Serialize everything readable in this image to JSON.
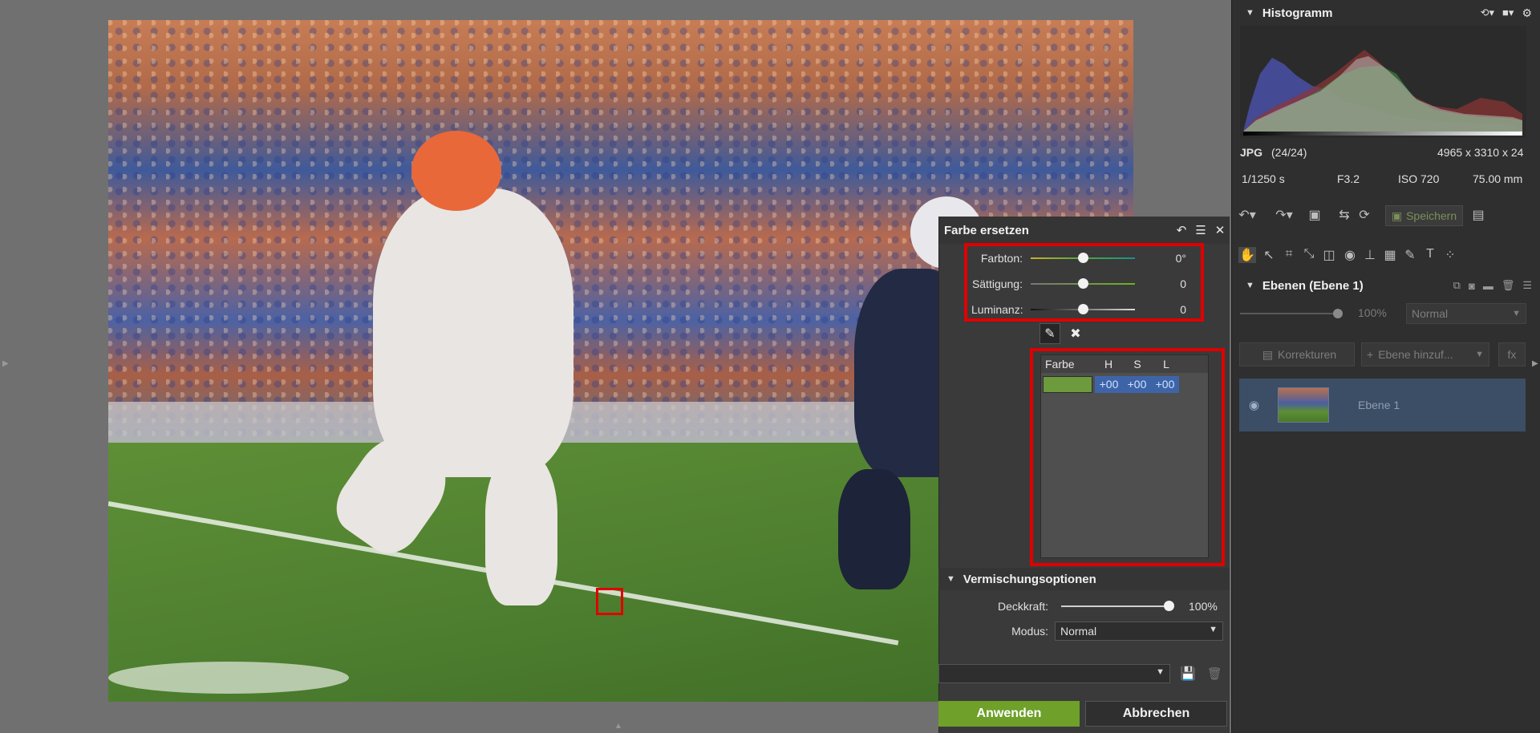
{
  "canvas": {
    "sample_marker": "color-sample-marker"
  },
  "dialog": {
    "title": "Farbe ersetzen",
    "icons": [
      "undo-icon",
      "menu-icon",
      "close-icon"
    ],
    "sliders": [
      {
        "label": "Farbton:",
        "value": "0°",
        "position": 0.5
      },
      {
        "label": "Sättigung:",
        "value": "0",
        "position": 0.5
      },
      {
        "label": "Luminanz:",
        "value": "0",
        "position": 0.5
      }
    ],
    "color_table": {
      "headers": [
        "Farbe",
        "H",
        "S",
        "L"
      ],
      "rows": [
        {
          "swatch": "#6c9a3d",
          "h": "+00",
          "s": "+00",
          "l": "+00"
        }
      ]
    },
    "blend": {
      "title": "Vermischungsoptionen",
      "opacity_label": "Deckkraft:",
      "opacity_value": "100%",
      "opacity_position": 1.0,
      "mode_label": "Modus:",
      "mode_value": "Normal"
    },
    "apply_label": "Anwenden",
    "cancel_label": "Abbrechen"
  },
  "right_panel": {
    "histogram": {
      "title": "Histogramm"
    },
    "info": {
      "format": "JPG",
      "count": "(24/24)",
      "dimensions": "4965 x 3310 x 24",
      "shutter": "1/1250 s",
      "aperture": "F3.2",
      "iso": "ISO 720",
      "focal": "75.00 mm"
    },
    "save_label": "Speichern",
    "layers": {
      "title": "Ebenen (Ebene 1)",
      "opacity": "100%",
      "blend_mode": "Normal",
      "corrections_label": "Korrekturen",
      "add_layer_label": "Ebene hinzuf...",
      "fx_label": "fx",
      "items": [
        {
          "name": "Ebene 1"
        }
      ]
    }
  },
  "colors": {
    "accent_green": "#6ea02a",
    "highlight_red": "#e00000",
    "selected_layer": "#3c4d66"
  }
}
